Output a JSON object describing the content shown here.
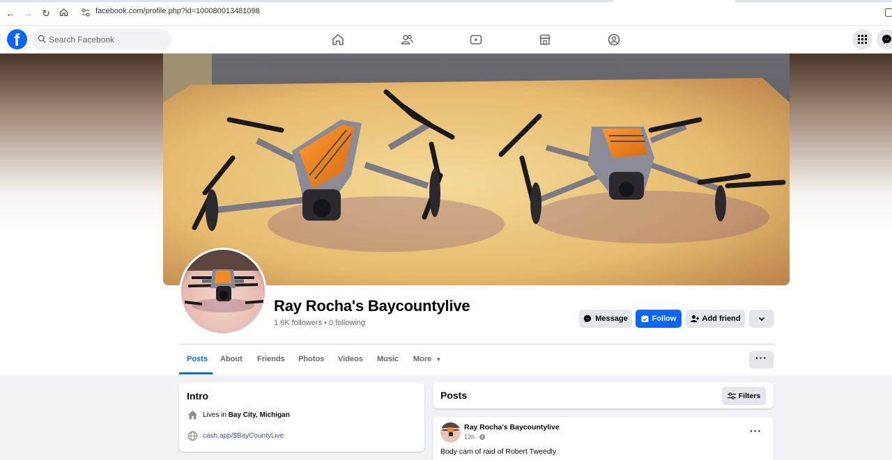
{
  "browser": {
    "url": "facebook.com/profile.php?id=100080013481098"
  },
  "topbar": {
    "logo_letter": "f",
    "search_placeholder": "Search Facebook",
    "nav_icons": [
      "home-icon",
      "friends-icon",
      "video-icon",
      "marketplace-icon",
      "groups-icon"
    ]
  },
  "profile": {
    "name": "Ray Rocha's Baycountylive",
    "followers_text": "1.6K followers • 0 following",
    "buttons": {
      "message": "Message",
      "follow": "Follow",
      "add_friend": "Add friend"
    }
  },
  "tabs": [
    {
      "label": "Posts"
    },
    {
      "label": "About"
    },
    {
      "label": "Friends"
    },
    {
      "label": "Photos"
    },
    {
      "label": "Videos"
    },
    {
      "label": "Music"
    },
    {
      "label": "More"
    }
  ],
  "intro": {
    "title": "Intro",
    "lives_prefix": "Lives in",
    "lives_place": "Bay City, Michigan",
    "website": "cash.app/$BayCountyLive"
  },
  "posts": {
    "title": "Posts",
    "filters_label": "Filters",
    "first_post": {
      "author": "Ray Rocha's Baycountylive",
      "time": "12h",
      "separator": "·",
      "text": "Body cam of raid of Robert Tweedly"
    }
  },
  "colors": {
    "brand": "#0866ff",
    "background": "#f0f2f5"
  }
}
